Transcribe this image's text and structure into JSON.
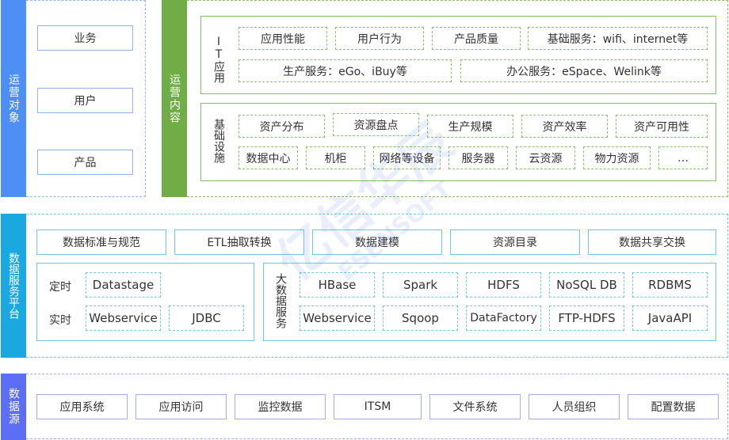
{
  "colors": {
    "ops_object": "#4d8ff5",
    "ops_content": "#70ad47",
    "data_service": "#1ba8e0",
    "data_source": "#5b6ef5",
    "box_blue_border": "#8db4f0",
    "box_green_border": "#85c25f",
    "box_cyan_border": "#6cc8e8",
    "box_purple_border": "#a3acf0"
  },
  "ops_object": {
    "title": "运营对象",
    "items": [
      "业务",
      "用户",
      "产品"
    ]
  },
  "ops_content": {
    "title": "运营内容",
    "it_app": {
      "label": "IT应用",
      "row1": [
        "应用性能",
        "用户行为",
        "产品质量",
        "基础服务：wifi、internet等"
      ],
      "row2": [
        "生产服务：eGo、iBuy等",
        "办公服务：eSpace、Welink等"
      ]
    },
    "infra": {
      "label": "基础设施",
      "row1": [
        "资产分布",
        "资源盘点",
        "生产规模",
        "资产效率",
        "资产可用性"
      ],
      "row2": [
        "数据中心",
        "机柜",
        "网络等设备",
        "服务器",
        "云资源",
        "物力资源",
        "…"
      ]
    }
  },
  "data_service": {
    "title": "数据服务平台",
    "top_row": [
      "数据标准与规范",
      "ETL抽取转换",
      "数据建模",
      "资源目录",
      "数据共享交换"
    ],
    "integration": {
      "scheduled_label": "定时",
      "scheduled_items": [
        "Datastage"
      ],
      "realtime_label": "实时",
      "realtime_items": [
        "Webservice",
        "JDBC"
      ]
    },
    "bigdata": {
      "label": "大数据服务",
      "row1": [
        "HBase",
        "Spark",
        "HDFS",
        "NoSQL DB",
        "RDBMS"
      ],
      "row2": [
        "Webservice",
        "Sqoop",
        "DataFactory",
        "FTP-HDFS",
        "JavaAPI"
      ]
    }
  },
  "data_source": {
    "title": "数据源",
    "items": [
      "应用系统",
      "应用访问",
      "监控数据",
      "ITSM",
      "文件系统",
      "人员组织",
      "配置数据"
    ]
  },
  "watermark": {
    "text1": "亿信华辰",
    "text2": "ESENSOFT"
  }
}
